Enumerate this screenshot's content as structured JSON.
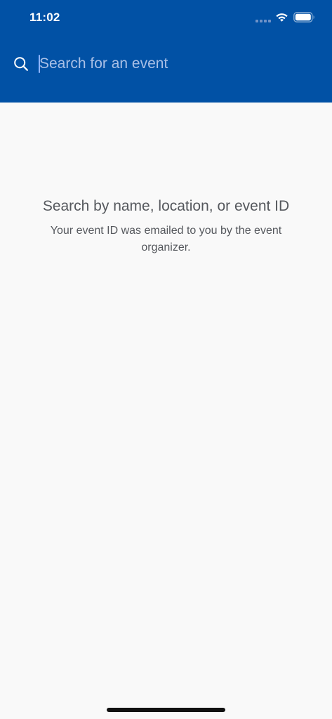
{
  "colors": {
    "header_bg": "#0151a5",
    "body_bg": "#f9f9f9",
    "caret": "#8fb4ff",
    "text_muted": "#55585d",
    "home_indicator": "#111111"
  },
  "status_bar": {
    "time": "11:02",
    "icons": [
      "cellular-signal-icon",
      "wifi-icon",
      "battery-icon"
    ]
  },
  "search": {
    "icon": "search-icon",
    "placeholder": "Search for an event",
    "value": ""
  },
  "empty_state": {
    "title": "Search by name, location, or event ID",
    "subtitle": "Your event ID was emailed to you by the event organizer."
  }
}
